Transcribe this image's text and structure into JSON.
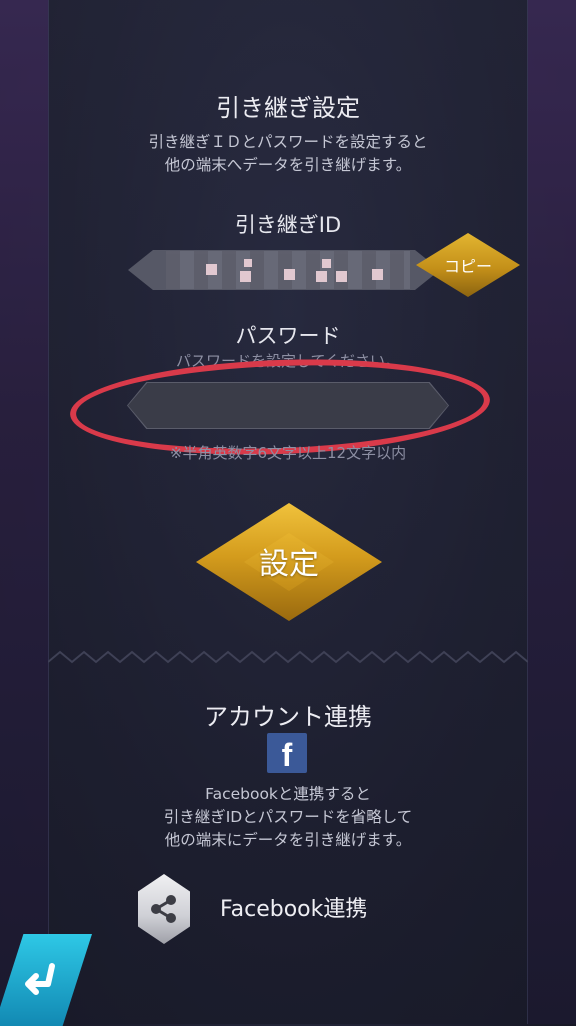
{
  "transfer": {
    "title": "引き継ぎ設定",
    "desc_line1": "引き継ぎＩＤとパスワードを設定すると",
    "desc_line2": "他の端末へデータを引き継げます。",
    "id_label": "引き継ぎID",
    "copy_label": "コピー",
    "password_label": "パスワード",
    "password_placeholder": "パスワードを設定してください。",
    "password_value": "",
    "password_rule": "※半角英数字6文字以上12文字以内",
    "set_button": "設定"
  },
  "account": {
    "title": "アカウント連携",
    "facebook_icon_glyph": "f",
    "desc_line1": "Facebookと連携すると",
    "desc_line2": "引き継ぎIDとパスワードを省略して",
    "desc_line3": "他の端末にデータを引き継げます。",
    "facebook_link_label": "Facebook連携"
  },
  "icons": {
    "copy": "copy-diamond-icon",
    "share": "share-icon",
    "back": "back-arrow-icon",
    "facebook": "facebook-icon"
  },
  "colors": {
    "gold_accent": "#d49c1d",
    "highlight_ring": "#d93a4a",
    "facebook_blue": "#3b5998",
    "back_button": "#1aa8d0"
  }
}
